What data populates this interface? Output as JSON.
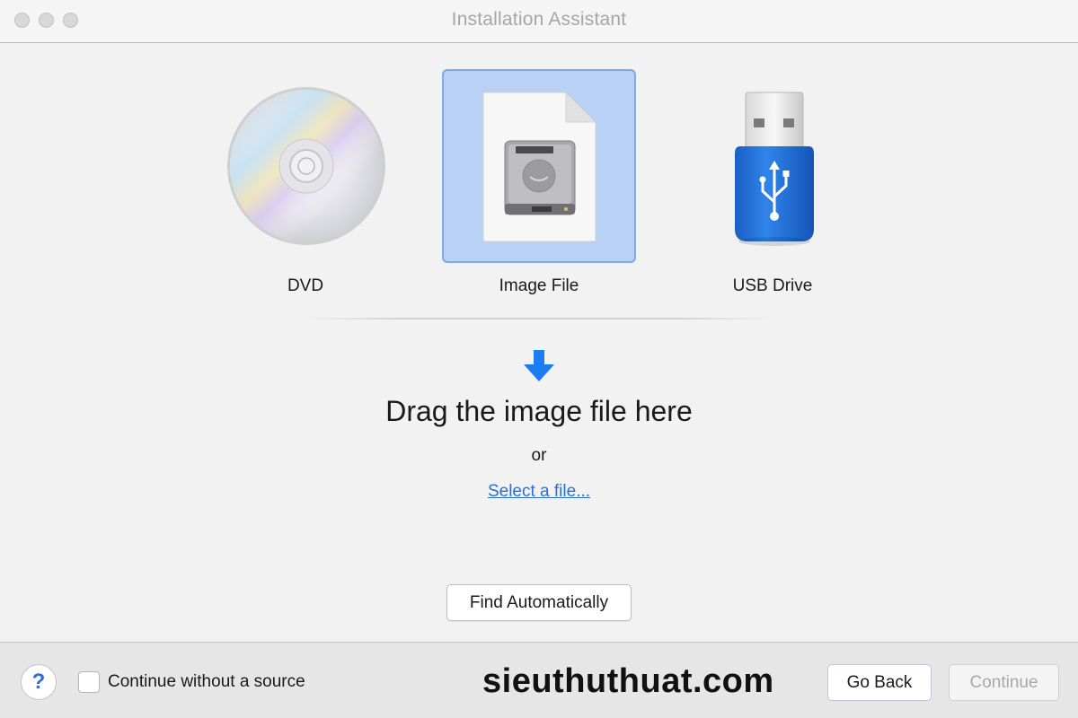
{
  "window": {
    "title": "Installation Assistant"
  },
  "sources": [
    {
      "label": "DVD",
      "icon": "dvd-disc-icon",
      "selected": false
    },
    {
      "label": "Image File",
      "icon": "disk-image-icon",
      "selected": true
    },
    {
      "label": "USB Drive",
      "icon": "usb-drive-icon",
      "selected": false
    }
  ],
  "drop_zone": {
    "arrow_icon": "down-arrow-icon",
    "heading": "Drag the image file here",
    "or_text": "or",
    "select_link": "Select a file..."
  },
  "find_button": "Find Automatically",
  "footer": {
    "help_label": "?",
    "checkbox_label": "Continue without a source",
    "checkbox_checked": false,
    "watermark": "sieuthuthuat.com",
    "back_button": "Go Back",
    "continue_button": "Continue",
    "continue_enabled": false
  },
  "colors": {
    "selection_bg": "#b8d1f5",
    "selection_border": "#7fa9e8",
    "accent_blue": "#1a7cf2",
    "link": "#2a6fd6"
  }
}
